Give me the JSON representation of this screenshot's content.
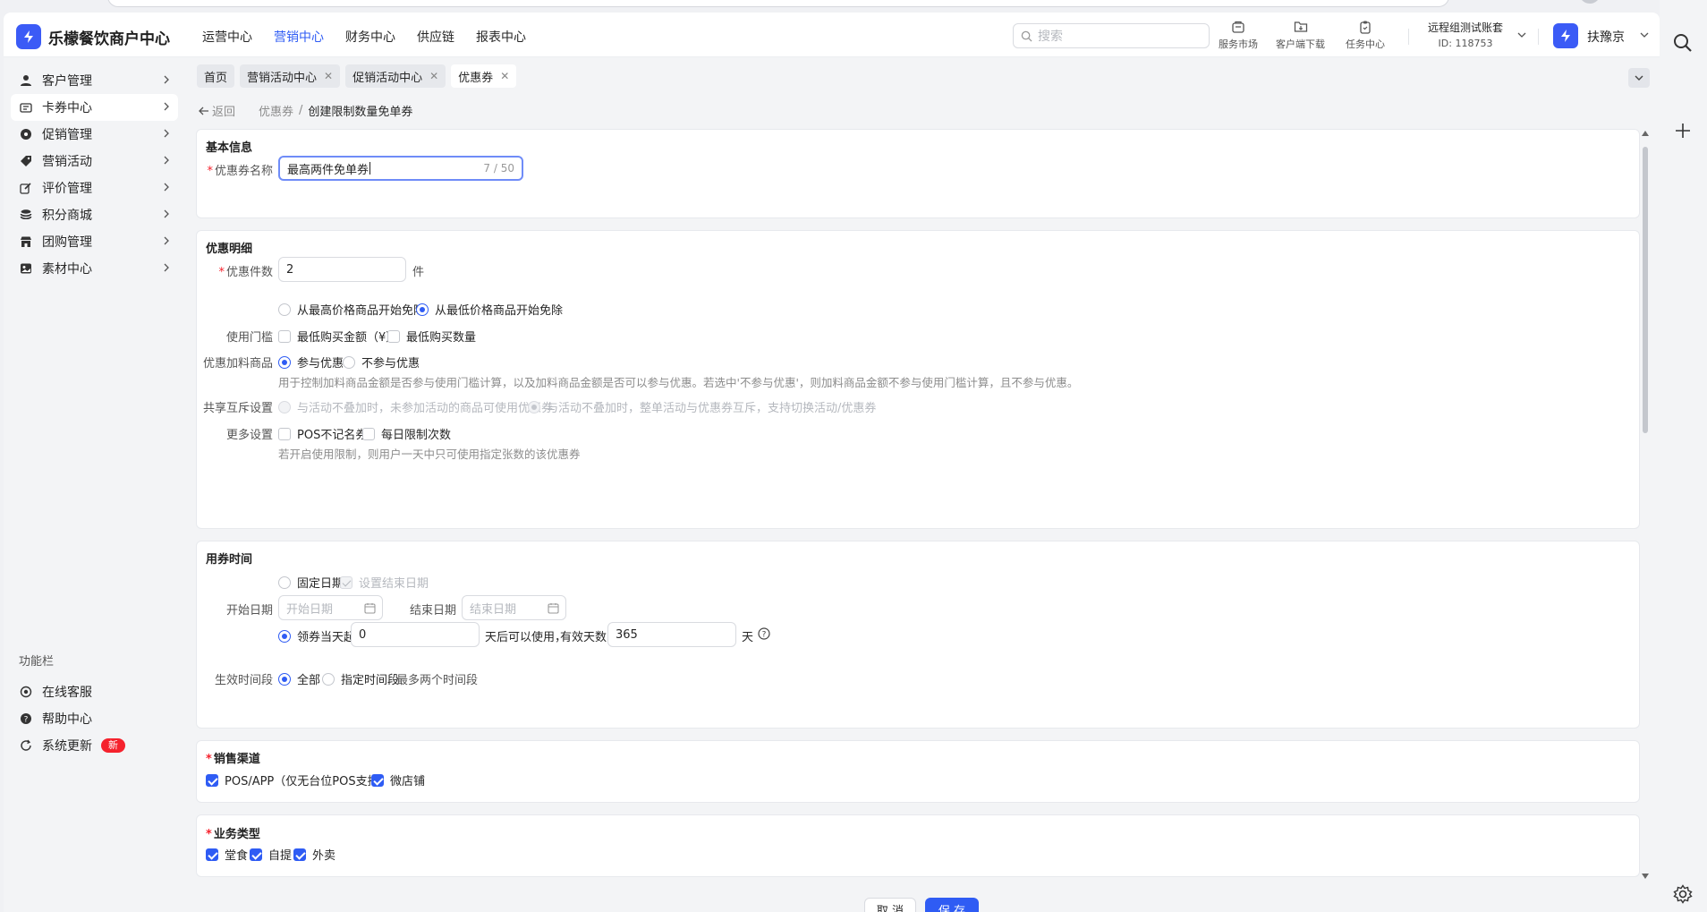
{
  "app": {
    "name": "乐檬餐饮商户中心",
    "brand_color": "#3b5bf6",
    "accent": "#2f5cf4"
  },
  "nav": [
    "运营中心",
    "营销中心",
    "财务中心",
    "供应链",
    "报表中心"
  ],
  "nav_active_index": 1,
  "search": {
    "placeholder": "搜索"
  },
  "tools": {
    "market": "服务市场",
    "download": "客户端下载",
    "tasks": "任务中心"
  },
  "account": {
    "name": "远程组测试账套",
    "id": "ID: 118753"
  },
  "user": {
    "name": "扶豫京"
  },
  "sidebar": {
    "items": [
      "客户管理",
      "卡券中心",
      "促销管理",
      "营销活动",
      "评价管理",
      "积分商城",
      "团购管理",
      "素材中心"
    ],
    "active_index": 1,
    "func_title": "功能栏",
    "func_items": [
      "在线客服",
      "帮助中心",
      "系统更新"
    ],
    "new_badge": "新"
  },
  "tabs": [
    "首页",
    "营销活动中心",
    "促销活动中心",
    "优惠券"
  ],
  "breadcrumb": {
    "back": "返回",
    "parent": "优惠券",
    "sep": "/",
    "current": "创建限制数量免单券"
  },
  "basic": {
    "title": "基本信息",
    "name_label": "优惠券名称",
    "name_value": "最高两件免单券",
    "name_count": "7 / 50"
  },
  "detail": {
    "title": "优惠明细",
    "qty_label": "优惠件数",
    "qty_value": "2",
    "qty_unit": "件",
    "order_opts": [
      "从最高价格商品开始免除",
      "从最低价格商品开始免除"
    ],
    "threshold_label": "使用门槛",
    "threshold_opts": [
      "最低购买金额（¥）",
      "最低购买数量"
    ],
    "addon_label": "优惠加料商品",
    "addon_opts": [
      "参与优惠",
      "不参与优惠"
    ],
    "addon_hint": "用于控制加料商品金额是否参与使用门槛计算，以及加料商品金额是否可以参与优惠。若选中'不参与优惠'，则加料商品金额不参与使用门槛计算，且不参与优惠。",
    "share_label": "共享互斥设置",
    "share_opts": [
      "与活动不叠加时，未参加活动的商品可使用优惠券",
      "与活动不叠加时，整单活动与优惠券互斥，支持切换活动/优惠券"
    ],
    "more_label": "更多设置",
    "more_opts": [
      "POS不记名券",
      "每日限制次数"
    ],
    "more_hint": "若开启使用限制，则用户一天中只可使用指定张数的该优惠券"
  },
  "time": {
    "title": "用券时间",
    "fixed_date": "固定日期",
    "set_end": "设置结束日期",
    "start_label": "开始日期",
    "start_ph": "开始日期",
    "end_label": "结束日期",
    "end_ph": "结束日期",
    "from_day": "领券当天起",
    "from_value": "0",
    "after_text": "天后可以使用，",
    "valid_label": "有效天数",
    "valid_value": "365",
    "day_unit": "天",
    "period_label": "生效时间段",
    "period_opts": [
      "全部",
      "指定时间段"
    ],
    "period_hint": "最多两个时间段"
  },
  "channel": {
    "title": "销售渠道",
    "opts": [
      "POS/APP（仅无台位POS支持）",
      "微店铺"
    ]
  },
  "biz": {
    "title": "业务类型",
    "opts": [
      "堂食",
      "自提",
      "外卖"
    ]
  },
  "footer": {
    "cancel": "取 消",
    "save": "保 存"
  }
}
